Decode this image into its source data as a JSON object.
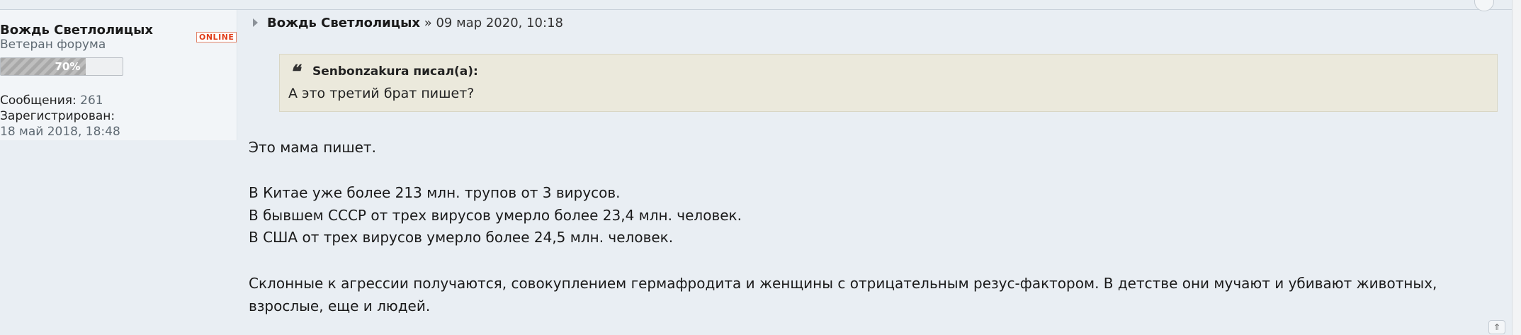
{
  "author": {
    "name": "Вождь Светлолицых",
    "status": "ONLINE",
    "rank": "Ветеран форума",
    "reputation_percent": 70,
    "reputation_label": "70%",
    "posts_label": "Сообщения:",
    "posts_value": "261",
    "registered_label": "Зарегистрирован:",
    "registered_value": "18 май 2018, 18:48"
  },
  "post": {
    "author": "Вождь Светлолицых",
    "separator": " » ",
    "date": "09 мар 2020, 10:18",
    "quote": {
      "icon": "❝",
      "author": "Senbonzakura писал(а):",
      "text": "А это третий брат пишет?"
    },
    "lines": [
      "Это мама пишет.",
      "В Китае уже более 213 млн. трупов от 3 вирусов.",
      "В бывшем СССР от трех вирусов умерло более 23,4 млн. человек.",
      "В США от трех вирусов умерло более 24,5 млн. человек.",
      "Склонные к агрессии получаются, совокуплением гермафродита и женщины с отрицательным резус-фактором. В детстве они мучают и убивают животных,",
      "взрослые, еще и людей."
    ]
  },
  "controls": {
    "page_up_icon": "⇑",
    "page_up": "≙"
  }
}
